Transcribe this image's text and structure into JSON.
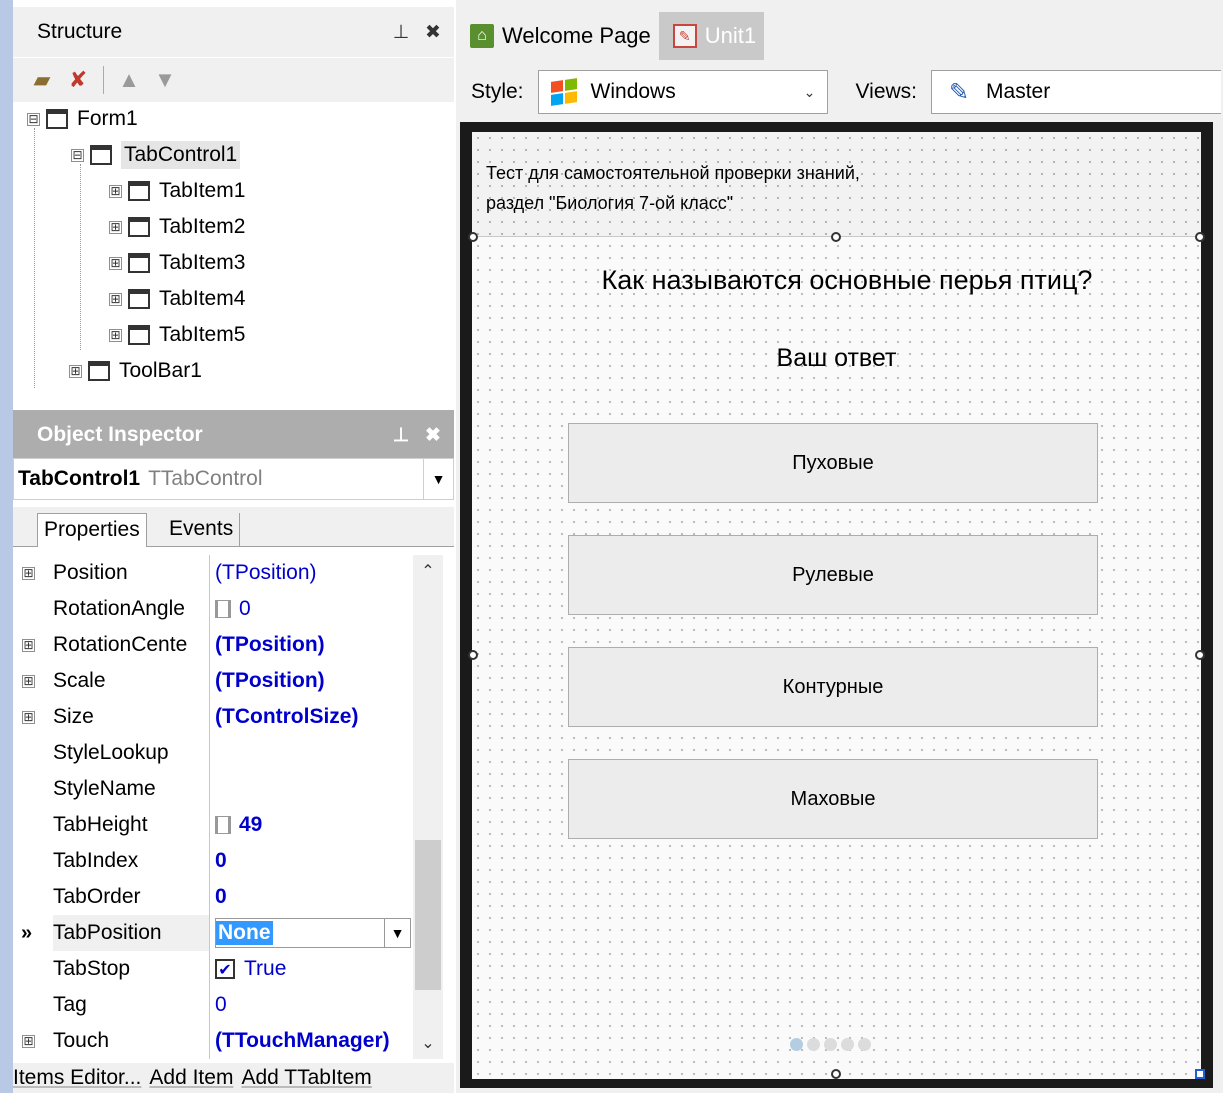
{
  "structure": {
    "title": "Structure",
    "tree": [
      {
        "label": "Form1"
      },
      {
        "label": "TabControl1"
      },
      {
        "label": "TabItem1"
      },
      {
        "label": "TabItem2"
      },
      {
        "label": "TabItem3"
      },
      {
        "label": "TabItem4"
      },
      {
        "label": "TabItem5"
      },
      {
        "label": "ToolBar1"
      }
    ],
    "expanded_glyph": "⊟",
    "collapsed_glyph": "⊞"
  },
  "inspector": {
    "title": "Object Inspector",
    "selected_name": "TabControl1",
    "selected_type": "TTabControl",
    "tabs": {
      "properties": "Properties",
      "events": "Events"
    },
    "rows": [
      {
        "name": "Position",
        "value": "(TPosition)"
      },
      {
        "name": "RotationAngle",
        "value": "0"
      },
      {
        "name": "RotationCente",
        "value": "(TPosition)"
      },
      {
        "name": "Scale",
        "value": "(TPosition)"
      },
      {
        "name": "Size",
        "value": "(TControlSize)"
      },
      {
        "name": "StyleLookup",
        "value": ""
      },
      {
        "name": "StyleName",
        "value": ""
      },
      {
        "name": "TabHeight",
        "value": "49"
      },
      {
        "name": "TabIndex",
        "value": "0"
      },
      {
        "name": "TabOrder",
        "value": "0"
      },
      {
        "name": "TabPosition",
        "value": "None"
      },
      {
        "name": "TabStop",
        "value": "True"
      },
      {
        "name": "Tag",
        "value": "0"
      },
      {
        "name": "Touch",
        "value": "(TTouchManager)"
      }
    ],
    "active_row_marker": "»",
    "footer": [
      "Items Editor...",
      "Add Item",
      "Add TTabItem"
    ]
  },
  "designer": {
    "tabs": [
      "Welcome Page",
      "Unit1"
    ],
    "style_label": "Style:",
    "style_value": "Windows",
    "views_label": "Views:",
    "views_value": "Master",
    "toolbar_label_line1": "Тест для самостоятельной проверки знаний,",
    "toolbar_label_line2": "раздел \"Биология 7-ой класс\"",
    "question": "Как называются основные перья птиц?",
    "answer_prompt": "Ваш ответ",
    "answers": [
      "Пуховые",
      "Рулевые",
      "Контурные",
      "Маховые"
    ],
    "page_count": 5,
    "active_page": 1
  },
  "colors": {
    "windows_logo": [
      "#f25022",
      "#7fba00",
      "#00a4ef",
      "#ffb900"
    ],
    "selection": "#3399ff",
    "value_blue": "#0000cc"
  }
}
